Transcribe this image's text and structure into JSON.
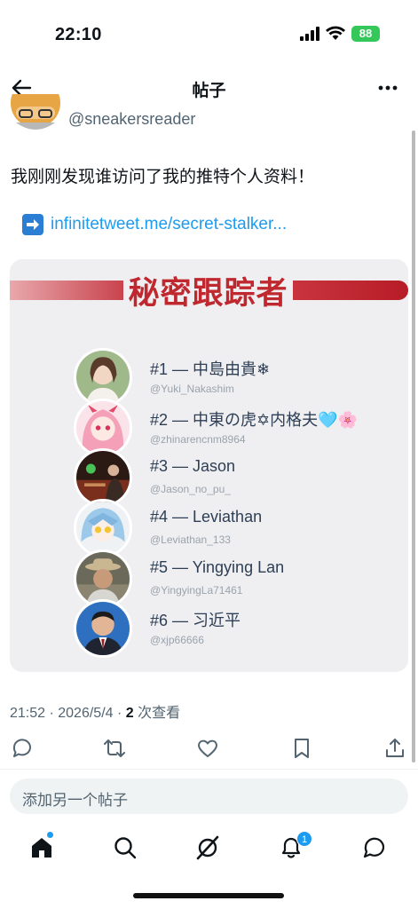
{
  "status": {
    "time": "22:10",
    "battery": "88"
  },
  "header": {
    "title": "帖子"
  },
  "post": {
    "handle": "@sneakersreader",
    "text": "我刚刚发现谁访问了我的推特个人资料！",
    "link": "infinitetweet.me/secret-stalker..."
  },
  "card": {
    "title": "秘密跟踪者",
    "users": [
      {
        "name": "#1 — 中島由貴❄",
        "handle": "@Yuki_Nakashim"
      },
      {
        "name": "#2 — 中東の虎✡内格夫🩵🌸",
        "handle": "@zhinarencnm8964"
      },
      {
        "name": "#3 — Jason",
        "handle": "@Jason_no_pu_"
      },
      {
        "name": "#4 — Leviathan",
        "handle": "@Leviathan_133"
      },
      {
        "name": "#5 — Yingying Lan",
        "handle": "@YingyingLa71461"
      },
      {
        "name": "#6 — 习近平",
        "handle": "@xjp66666"
      }
    ]
  },
  "meta": {
    "time_date": "21:52 · 2026/5/4 · ",
    "views_count": "2",
    "views_label": " 次查看"
  },
  "reply": {
    "placeholder": "添加另一个帖子"
  },
  "tabs": {
    "notification_count": "1"
  },
  "colors": {
    "accent": "#1d9bf0",
    "title_red": "#c0282f",
    "battery": "#34c759"
  }
}
